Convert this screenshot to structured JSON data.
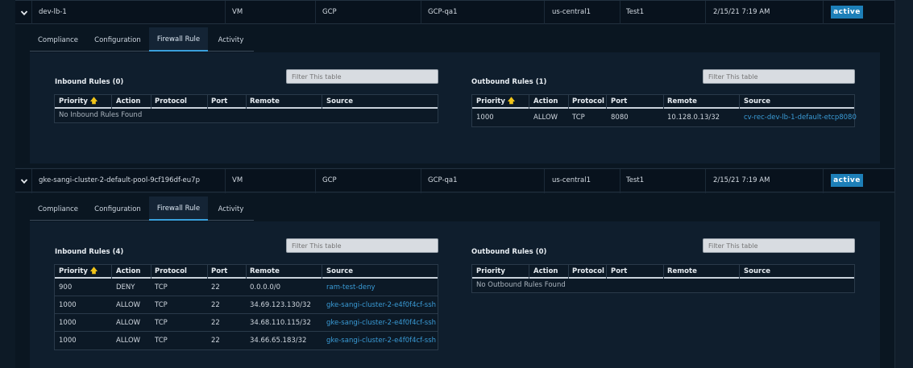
{
  "resources": [
    {
      "name": "dev-lb-1",
      "type": "VM",
      "cloud": "GCP",
      "account": "GCP-qa1",
      "region": "us-central1",
      "tenant": "Test1",
      "date": "2/15/21 7:19 AM",
      "status": "active",
      "tabs": [
        "Compliance",
        "Configuration",
        "Firewall Rule",
        "Activity"
      ],
      "active_tab": "Firewall Rule",
      "inbound": {
        "title": "Inbound Rules (0)",
        "filter_placeholder": "Filter This table",
        "columns": [
          "Priority",
          "Action",
          "Protocol",
          "Port",
          "Remote",
          "Source"
        ],
        "empty": "No Inbound Rules Found",
        "rows": []
      },
      "outbound": {
        "title": "Outbound Rules (1)",
        "filter_placeholder": "Filter This table",
        "columns": [
          "Priority",
          "Action",
          "Protocol",
          "Port",
          "Remote",
          "Source"
        ],
        "rows": [
          {
            "priority": "1000",
            "action": "ALLOW",
            "protocol": "TCP",
            "port": "8080",
            "remote": "10.128.0.13/32",
            "source": "cv-rec-dev-lb-1-default-etcp8080"
          }
        ]
      }
    },
    {
      "name": "gke-sangi-cluster-2-default-pool-9cf196df-eu7p",
      "type": "VM",
      "cloud": "GCP",
      "account": "GCP-qa1",
      "region": "us-central1",
      "tenant": "Test1",
      "date": "2/15/21 7:19 AM",
      "status": "active",
      "tabs": [
        "Compliance",
        "Configuration",
        "Firewall Rule",
        "Activity"
      ],
      "active_tab": "Firewall Rule",
      "inbound": {
        "title": "Inbound Rules (4)",
        "filter_placeholder": "Filter This table",
        "columns": [
          "Priority",
          "Action",
          "Protocol",
          "Port",
          "Remote",
          "Source"
        ],
        "rows": [
          {
            "priority": "900",
            "action": "DENY",
            "protocol": "TCP",
            "port": "22",
            "remote": "0.0.0.0/0",
            "source": "ram-test-deny"
          },
          {
            "priority": "1000",
            "action": "ALLOW",
            "protocol": "TCP",
            "port": "22",
            "remote": "34.69.123.130/32",
            "source": "gke-sangi-cluster-2-e4f0f4cf-ssh"
          },
          {
            "priority": "1000",
            "action": "ALLOW",
            "protocol": "TCP",
            "port": "22",
            "remote": "34.68.110.115/32",
            "source": "gke-sangi-cluster-2-e4f0f4cf-ssh"
          },
          {
            "priority": "1000",
            "action": "ALLOW",
            "protocol": "TCP",
            "port": "22",
            "remote": "34.66.65.183/32",
            "source": "gke-sangi-cluster-2-e4f0f4cf-ssh"
          }
        ]
      },
      "outbound": {
        "title": "Outbound Rules (0)",
        "filter_placeholder": "Filter This table",
        "columns": [
          "Priority",
          "Action",
          "Protocol",
          "Port",
          "Remote",
          "Source"
        ],
        "empty": "No Outbound Rules Found",
        "rows": []
      }
    }
  ],
  "colors": {
    "accent": "#1d7fb8",
    "link": "#3a9bd6",
    "sort_arrow": "#f0c419",
    "background": "#0d1a26"
  },
  "icons": {
    "expand": "chevron-down-icon",
    "sort": "arrow-up-icon"
  }
}
